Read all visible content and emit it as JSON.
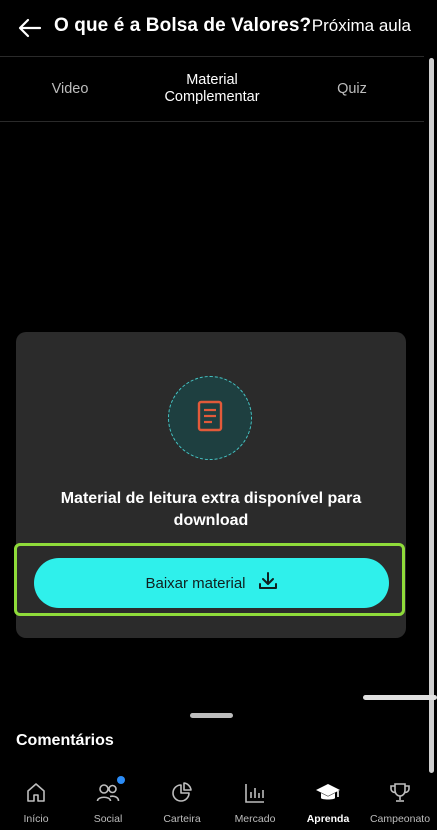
{
  "header": {
    "title": "O que é a Bolsa de Valores?",
    "next_label": "Próxima aula"
  },
  "tabs": [
    {
      "label": "Video",
      "active": false
    },
    {
      "label": "Material\nComplementar",
      "active": true
    },
    {
      "label": "Quiz",
      "active": false
    }
  ],
  "card": {
    "message": "Material de leitura extra disponível para download",
    "button_label": "Baixar material"
  },
  "comments": {
    "title": "Comentários"
  },
  "nav": [
    {
      "label": "Início",
      "icon": "home-icon"
    },
    {
      "label": "Social",
      "icon": "people-icon"
    },
    {
      "label": "Carteira",
      "icon": "pie-chart-icon"
    },
    {
      "label": "Mercado",
      "icon": "bar-chart-icon"
    },
    {
      "label": "Aprenda",
      "icon": "graduation-cap-icon",
      "active": true
    },
    {
      "label": "Campeonato",
      "icon": "trophy-icon"
    }
  ],
  "colors": {
    "accent": "#2ff0eb",
    "highlight": "#8fdc3a",
    "document_icon": "#e25a3a",
    "badge": "#2b8cf7"
  }
}
